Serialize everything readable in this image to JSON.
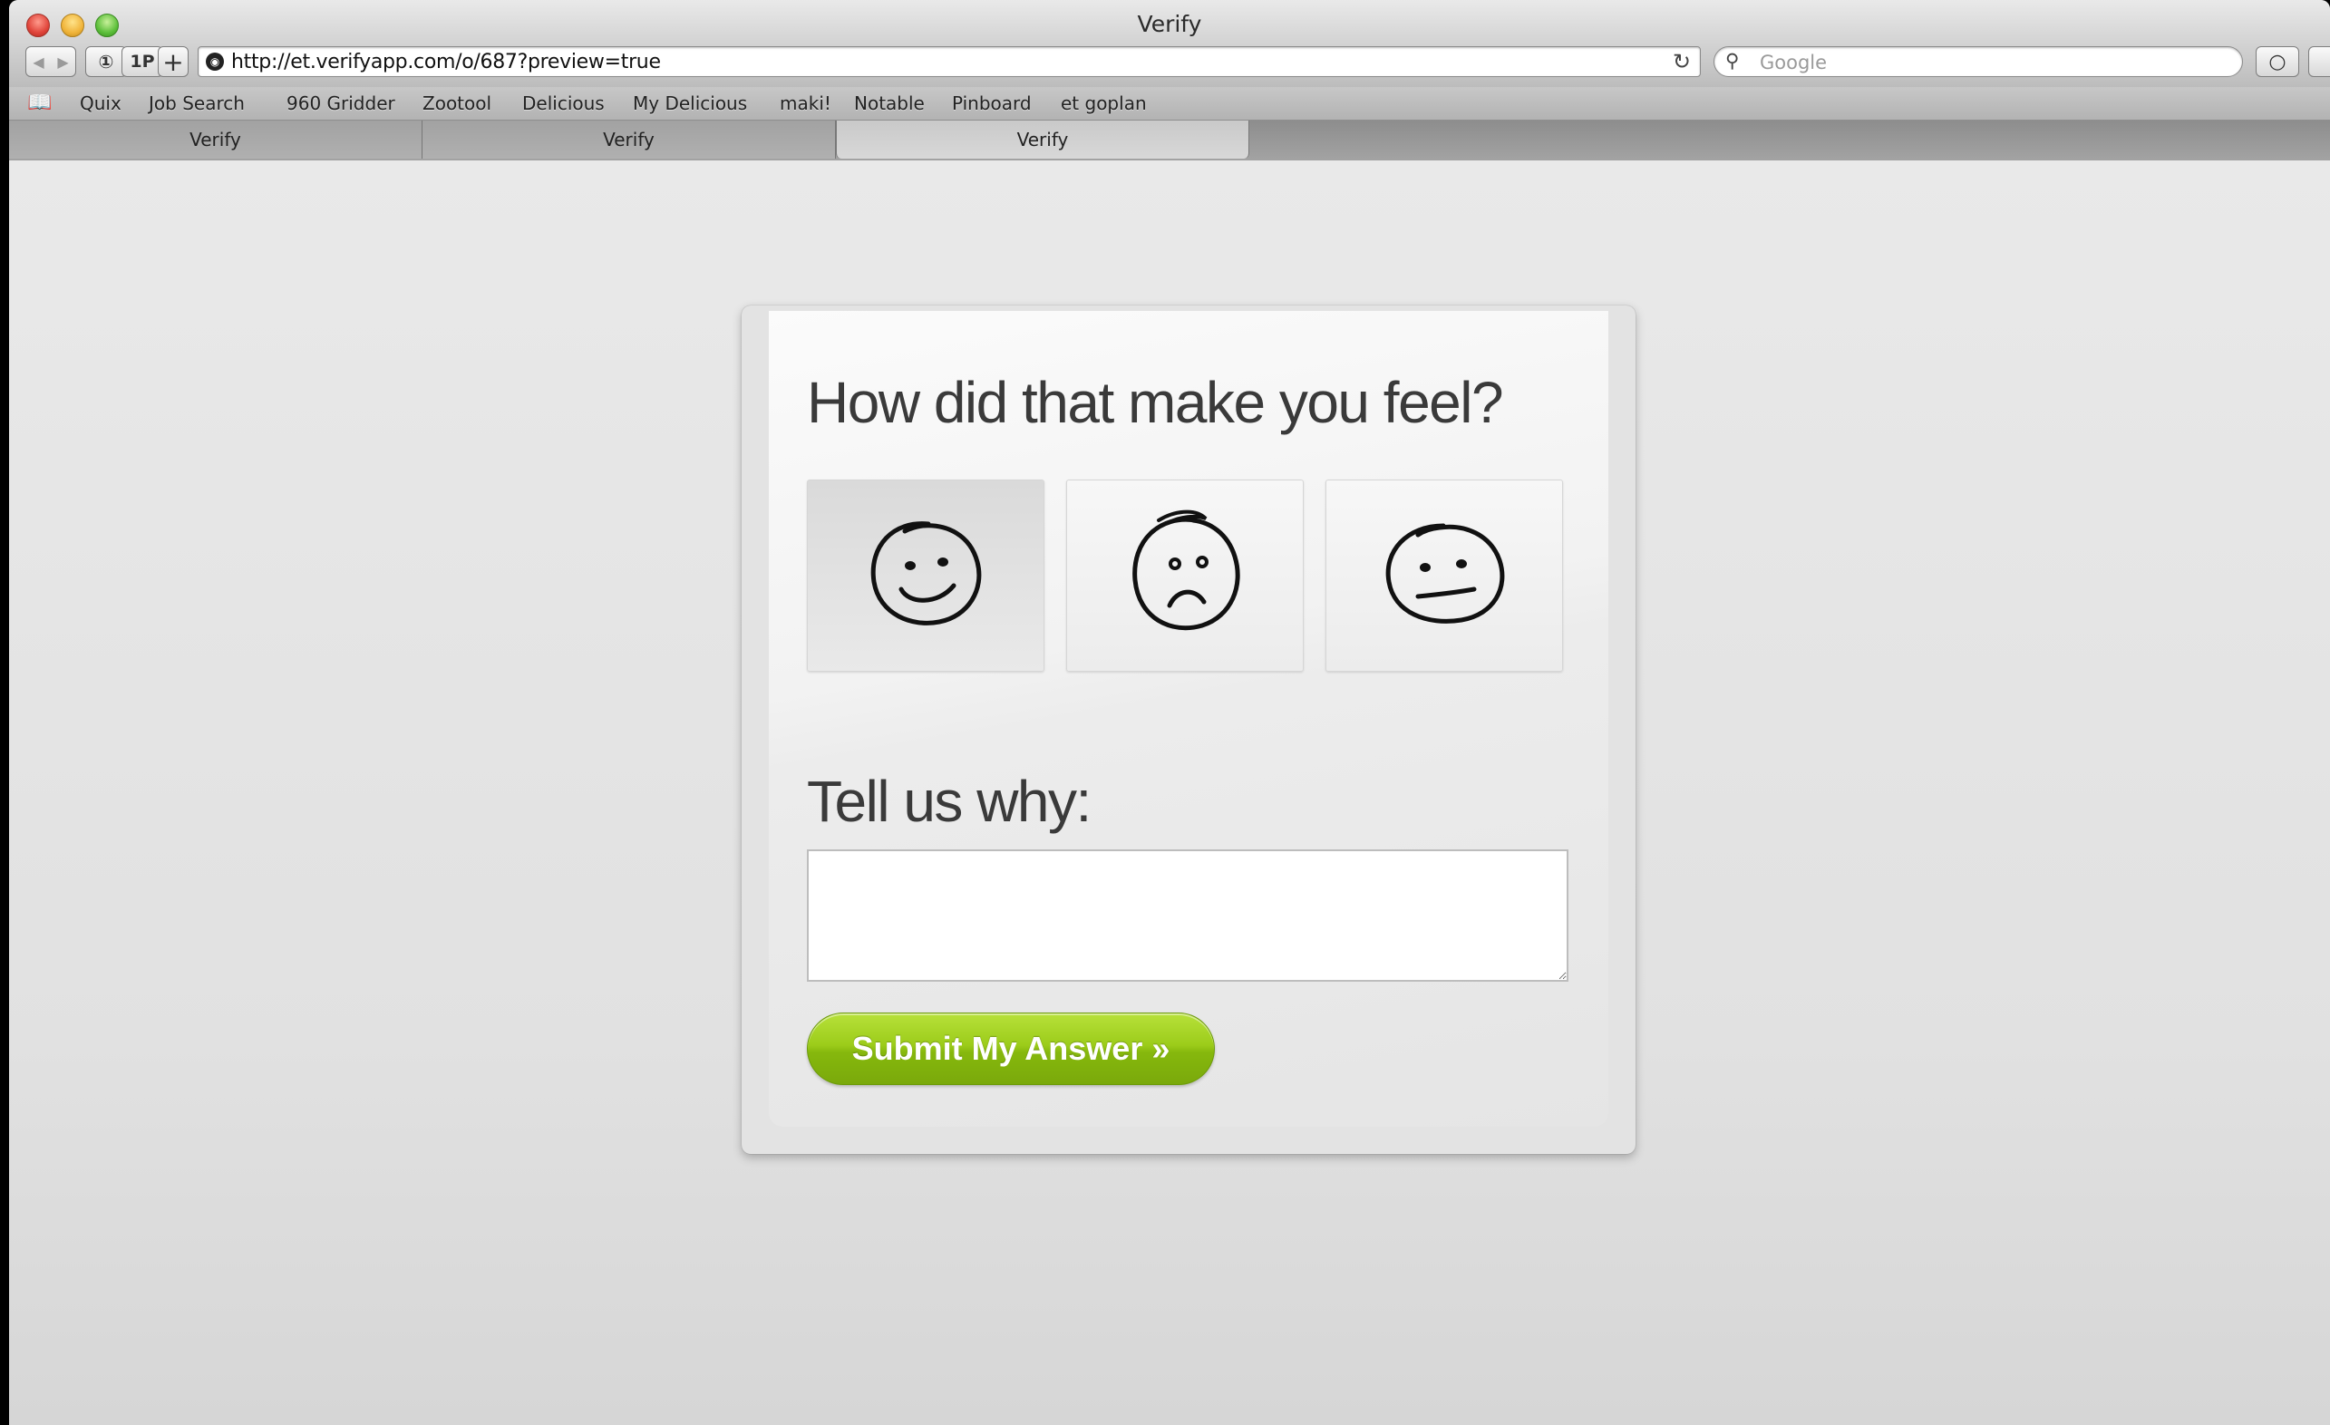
{
  "window": {
    "title": "Verify"
  },
  "toolbar": {
    "back_label": "◀",
    "forward_label": "▶",
    "btn1_label": "①",
    "btn1p_label": "1P",
    "add_label": "+",
    "url": "http://et.verifyapp.com/o/687?preview=true",
    "search_placeholder": "Google",
    "icons": {
      "reload": "reload-icon",
      "search": "search-icon",
      "site": "globe-icon"
    }
  },
  "bookmarks": [
    {
      "label": "Quix"
    },
    {
      "label": "Job Search"
    },
    {
      "label": "960 Gridder"
    },
    {
      "label": "Zootool"
    },
    {
      "label": "Delicious"
    },
    {
      "label": "My Delicious"
    },
    {
      "label": "maki!"
    },
    {
      "label": "Notable"
    },
    {
      "label": "Pinboard"
    },
    {
      "label": "et goplan"
    }
  ],
  "tabs": [
    {
      "label": "Verify",
      "active": false
    },
    {
      "label": "Verify",
      "active": false
    },
    {
      "label": "Verify",
      "active": true
    }
  ],
  "survey": {
    "question": "How did that make you feel?",
    "options": [
      {
        "name": "happy",
        "icon": "happy-face-icon",
        "selected": true
      },
      {
        "name": "sad",
        "icon": "sad-face-icon",
        "selected": false
      },
      {
        "name": "neutral",
        "icon": "neutral-face-icon",
        "selected": false
      }
    ],
    "why_label": "Tell us why:",
    "why_value": "",
    "submit_label": "Submit My Answer »"
  },
  "colors": {
    "accent": "#8dbd12",
    "text": "#3a3a3a"
  }
}
